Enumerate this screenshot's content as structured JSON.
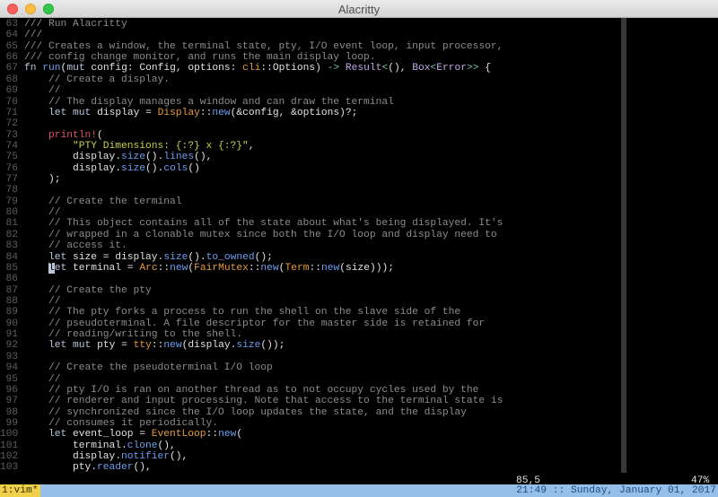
{
  "window": {
    "title": "Alacritty"
  },
  "editor": {
    "lines": [
      {
        "n": "63",
        "t": [
          [
            "/// Run Alacritty",
            "c"
          ]
        ]
      },
      {
        "n": "64",
        "t": [
          [
            "///",
            "c"
          ]
        ]
      },
      {
        "n": "65",
        "t": [
          [
            "/// Creates a window, the terminal state, pty, I/O event loop, input processor,",
            "c"
          ]
        ]
      },
      {
        "n": "66",
        "t": [
          [
            "/// config change monitor, and runs the main display loop.",
            "c"
          ]
        ]
      },
      {
        "n": "67",
        "t": [
          [
            "fn",
            "k"
          ],
          [
            " ",
            ""
          ],
          [
            "run",
            "f"
          ],
          [
            "(",
            ""
          ],
          [
            "mut",
            "k"
          ],
          [
            " config: Config, options: ",
            ""
          ],
          [
            "cli",
            "t"
          ],
          [
            "::Options) ",
            ""
          ],
          [
            "->",
            "o"
          ],
          [
            " ",
            ""
          ],
          [
            "Result",
            "p"
          ],
          [
            "<",
            "o"
          ],
          [
            "(), ",
            ""
          ],
          [
            "Box",
            "p"
          ],
          [
            "<",
            "o"
          ],
          [
            "Error",
            "p"
          ],
          [
            ">>",
            "o"
          ],
          [
            " {",
            ""
          ]
        ]
      },
      {
        "n": "68",
        "t": [
          [
            "    // Create a display.",
            "c"
          ]
        ]
      },
      {
        "n": "69",
        "t": [
          [
            "    //",
            "c"
          ]
        ]
      },
      {
        "n": "70",
        "t": [
          [
            "    // The display manages a window and can draw the terminal",
            "c"
          ]
        ]
      },
      {
        "n": "71",
        "t": [
          [
            "    ",
            ""
          ],
          [
            "let",
            "k"
          ],
          [
            " ",
            ""
          ],
          [
            "mut",
            "k"
          ],
          [
            " display = ",
            ""
          ],
          [
            "Display",
            "t"
          ],
          [
            "::",
            ""
          ],
          [
            "new",
            "f"
          ],
          [
            "(&config, &options)?;",
            ""
          ]
        ]
      },
      {
        "n": "72",
        "t": []
      },
      {
        "n": "73",
        "t": [
          [
            "    ",
            ""
          ],
          [
            "println!",
            "m"
          ],
          [
            "(",
            ""
          ]
        ]
      },
      {
        "n": "74",
        "t": [
          [
            "        ",
            ""
          ],
          [
            "\"PTY Dimensions: {:?} x {:?}\"",
            "s"
          ],
          [
            ",",
            ""
          ]
        ]
      },
      {
        "n": "75",
        "t": [
          [
            "        display.",
            ""
          ],
          [
            "size",
            "f"
          ],
          [
            "().",
            ""
          ],
          [
            "lines",
            "f"
          ],
          [
            "(),",
            ""
          ]
        ]
      },
      {
        "n": "76",
        "t": [
          [
            "        display.",
            ""
          ],
          [
            "size",
            "f"
          ],
          [
            "().",
            ""
          ],
          [
            "cols",
            "f"
          ],
          [
            "()",
            ""
          ]
        ]
      },
      {
        "n": "77",
        "t": [
          [
            "    );",
            ""
          ]
        ]
      },
      {
        "n": "78",
        "t": []
      },
      {
        "n": "79",
        "t": [
          [
            "    // Create the terminal",
            "c"
          ]
        ]
      },
      {
        "n": "80",
        "t": [
          [
            "    //",
            "c"
          ]
        ]
      },
      {
        "n": "81",
        "t": [
          [
            "    // This object contains all of the state about what's being displayed. It's",
            "c"
          ]
        ]
      },
      {
        "n": "82",
        "t": [
          [
            "    // wrapped in a clonable mutex since both the I/O loop and display need to",
            "c"
          ]
        ]
      },
      {
        "n": "83",
        "t": [
          [
            "    // access it.",
            "c"
          ]
        ]
      },
      {
        "n": "84",
        "t": [
          [
            "    ",
            ""
          ],
          [
            "let",
            "k"
          ],
          [
            " size = display.",
            ""
          ],
          [
            "size",
            "f"
          ],
          [
            "().",
            ""
          ],
          [
            "to_owned",
            "f"
          ],
          [
            "();",
            ""
          ]
        ]
      },
      {
        "n": "85",
        "t": [
          [
            "    ",
            ""
          ],
          [
            "l",
            "cur"
          ],
          [
            "et",
            "k"
          ],
          [
            " terminal = ",
            ""
          ],
          [
            "Arc",
            "t"
          ],
          [
            "::",
            ""
          ],
          [
            "new",
            "f"
          ],
          [
            "(",
            ""
          ],
          [
            "FairMutex",
            "t"
          ],
          [
            "::",
            ""
          ],
          [
            "new",
            "f"
          ],
          [
            "(",
            ""
          ],
          [
            "Term",
            "t"
          ],
          [
            "::",
            ""
          ],
          [
            "new",
            "f"
          ],
          [
            "(size)));",
            ""
          ]
        ]
      },
      {
        "n": "86",
        "t": []
      },
      {
        "n": "87",
        "t": [
          [
            "    // Create the pty",
            "c"
          ]
        ]
      },
      {
        "n": "88",
        "t": [
          [
            "    //",
            "c"
          ]
        ]
      },
      {
        "n": "89",
        "t": [
          [
            "    // The pty forks a process to run the shell on the slave side of the",
            "c"
          ]
        ]
      },
      {
        "n": "90",
        "t": [
          [
            "    // pseudoterminal. A file descriptor for the master side is retained for",
            "c"
          ]
        ]
      },
      {
        "n": "91",
        "t": [
          [
            "    // reading/writing to the shell.",
            "c"
          ]
        ]
      },
      {
        "n": "92",
        "t": [
          [
            "    ",
            ""
          ],
          [
            "let",
            "k"
          ],
          [
            " ",
            ""
          ],
          [
            "mut",
            "k"
          ],
          [
            " pty = ",
            ""
          ],
          [
            "tty",
            "t"
          ],
          [
            "::",
            ""
          ],
          [
            "new",
            "f"
          ],
          [
            "(display.",
            ""
          ],
          [
            "size",
            "f"
          ],
          [
            "());",
            ""
          ]
        ]
      },
      {
        "n": "93",
        "t": []
      },
      {
        "n": "94",
        "t": [
          [
            "    // Create the pseudoterminal I/O loop",
            "c"
          ]
        ]
      },
      {
        "n": "95",
        "t": [
          [
            "    //",
            "c"
          ]
        ]
      },
      {
        "n": "96",
        "t": [
          [
            "    // pty I/O is ran on another thread as to not occupy cycles used by the",
            "c"
          ]
        ]
      },
      {
        "n": "97",
        "t": [
          [
            "    // renderer and input processing. Note that access to the terminal state is",
            "c"
          ]
        ]
      },
      {
        "n": "98",
        "t": [
          [
            "    // synchronized since the I/O loop updates the state, and the display",
            "c"
          ]
        ]
      },
      {
        "n": "99",
        "t": [
          [
            "    // consumes it periodically.",
            "c"
          ]
        ]
      },
      {
        "n": "100",
        "t": [
          [
            "    ",
            ""
          ],
          [
            "let",
            "k"
          ],
          [
            " event_loop = ",
            ""
          ],
          [
            "EventLoop",
            "t"
          ],
          [
            "::",
            ""
          ],
          [
            "new",
            "f"
          ],
          [
            "(",
            ""
          ]
        ]
      },
      {
        "n": "101",
        "t": [
          [
            "        terminal.",
            ""
          ],
          [
            "clone",
            "f"
          ],
          [
            "(),",
            ""
          ]
        ]
      },
      {
        "n": "102",
        "t": [
          [
            "        display.",
            ""
          ],
          [
            "notifier",
            "f"
          ],
          [
            "(),",
            ""
          ]
        ]
      },
      {
        "n": "103",
        "t": [
          [
            "        pty.",
            ""
          ],
          [
            "reader",
            "f"
          ],
          [
            "(),",
            ""
          ]
        ]
      }
    ],
    "cursor_position": "85,5",
    "scroll_percent": "47%"
  },
  "statusbar": {
    "window_label": "1:vim*",
    "clock": "21:49 :: Sunday, January 01, 2017"
  }
}
